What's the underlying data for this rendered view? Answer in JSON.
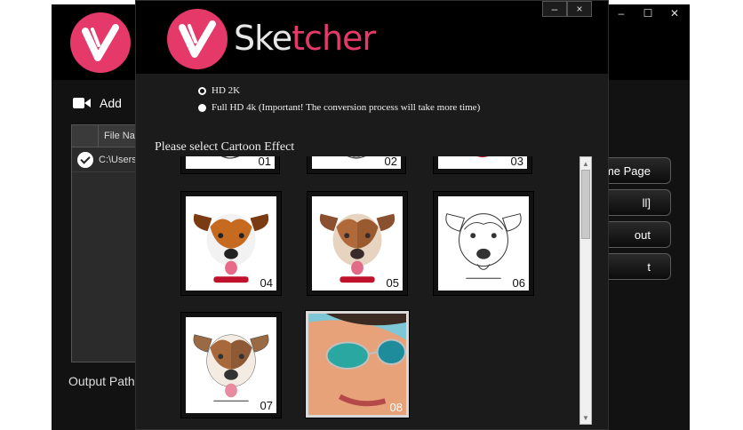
{
  "app": {
    "name": "Sketcher",
    "brand_color": "#e5396a"
  },
  "back_window": {
    "add_label": "Add",
    "file_table": {
      "column_header": "File Na",
      "rows": [
        {
          "path": "C:\\Users"
        }
      ]
    },
    "output_path_label": "Output Path",
    "side_buttons": [
      "me Page",
      "ll]",
      "out",
      "t"
    ]
  },
  "dialog": {
    "window_controls": {
      "minimize": "–",
      "close": "×"
    },
    "resolution_options": [
      {
        "label": "HD 2K",
        "selected": true
      },
      {
        "label": "Full HD 4k (Important! The conversion process will take more time)",
        "selected": false
      }
    ],
    "select_prompt": "Please select Cartoon Effect",
    "effects": [
      {
        "id": "01",
        "style": "sketch"
      },
      {
        "id": "02",
        "style": "sketch"
      },
      {
        "id": "03",
        "style": "color"
      },
      {
        "id": "04",
        "style": "photo"
      },
      {
        "id": "05",
        "style": "painted"
      },
      {
        "id": "06",
        "style": "pencil"
      },
      {
        "id": "07",
        "style": "colored-pencil"
      },
      {
        "id": "08",
        "style": "oil-paint"
      }
    ]
  }
}
